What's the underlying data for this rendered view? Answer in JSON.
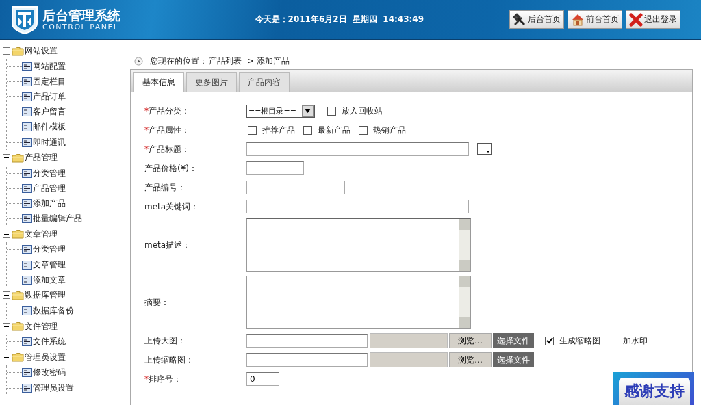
{
  "header": {
    "logo_title": "后台管理系统",
    "logo_subtitle": "CONTROL PANEL",
    "date_text": "今天是：2011年6月2日  星期四  14:43:49",
    "buttons": [
      {
        "kind": "tools",
        "label": "后台首页"
      },
      {
        "kind": "home",
        "label": "前台首页"
      },
      {
        "kind": "logout",
        "label": "退出登录"
      }
    ]
  },
  "sidebar": {
    "groups": [
      {
        "label": "网站设置",
        "expanded": true,
        "children": [
          {
            "label": "网站配置"
          },
          {
            "label": "固定栏目"
          },
          {
            "label": "产品订单"
          },
          {
            "label": "客户留言"
          },
          {
            "label": "邮件模板"
          },
          {
            "label": "即时通讯"
          }
        ]
      },
      {
        "label": "产品管理",
        "expanded": true,
        "children": [
          {
            "label": "分类管理"
          },
          {
            "label": "产品管理"
          },
          {
            "label": "添加产品"
          },
          {
            "label": "批量编辑产品"
          }
        ]
      },
      {
        "label": "文章管理",
        "expanded": true,
        "children": [
          {
            "label": "分类管理"
          },
          {
            "label": "文章管理"
          },
          {
            "label": "添加文章"
          }
        ]
      },
      {
        "label": "数据库管理",
        "expanded": true,
        "children": [
          {
            "label": "数据库备份"
          }
        ]
      },
      {
        "label": "文件管理",
        "expanded": true,
        "children": [
          {
            "label": "文件系统"
          }
        ]
      },
      {
        "label": "管理员设置",
        "expanded": true,
        "children": [
          {
            "label": "修改密码"
          },
          {
            "label": "管理员设置"
          }
        ]
      }
    ]
  },
  "breadcrumb": {
    "prefix": "您现在的位置：",
    "items": [
      "产品列表",
      "> 添加产品"
    ]
  },
  "tabs": [
    {
      "label": "基本信息",
      "selected": true
    },
    {
      "label": "更多图片",
      "selected": false
    },
    {
      "label": "产品内容",
      "selected": false
    }
  ],
  "form": [
    {
      "kind": "select",
      "label": "产品分类：",
      "mark": "*",
      "value": "==根目录==",
      "options": [
        {
          "label": "放入回收站",
          "checked": false
        }
      ]
    },
    {
      "kind": "checks",
      "label": "产品属性：",
      "mark": "*",
      "options": [
        {
          "label": "推荐产品",
          "checked": false
        },
        {
          "label": "最新产品",
          "checked": false
        },
        {
          "label": "热销产品",
          "checked": false
        }
      ]
    },
    {
      "kind": "title",
      "label": "产品标题：",
      "mark": "*"
    },
    {
      "kind": "short",
      "label": "产品价格(¥)："
    },
    {
      "kind": "medium",
      "label": "产品编号："
    },
    {
      "kind": "long",
      "label": "meta关键词："
    },
    {
      "kind": "textarea",
      "label": "meta描述："
    },
    {
      "kind": "textarea",
      "label": "摘要："
    },
    {
      "kind": "file",
      "label": "上传大图：",
      "browse": "浏览...",
      "choose": "选择文件",
      "options": [
        {
          "label": "生成缩略图",
          "checked": true
        },
        {
          "label": "加水印",
          "checked": false
        }
      ]
    },
    {
      "kind": "file",
      "label": "上传缩略图：",
      "browse": "浏览...",
      "choose": "选择文件"
    },
    {
      "kind": "number",
      "label": "排序号：",
      "mark": "*",
      "value": "0"
    }
  ],
  "support_badge": {
    "label": "感谢支持"
  }
}
